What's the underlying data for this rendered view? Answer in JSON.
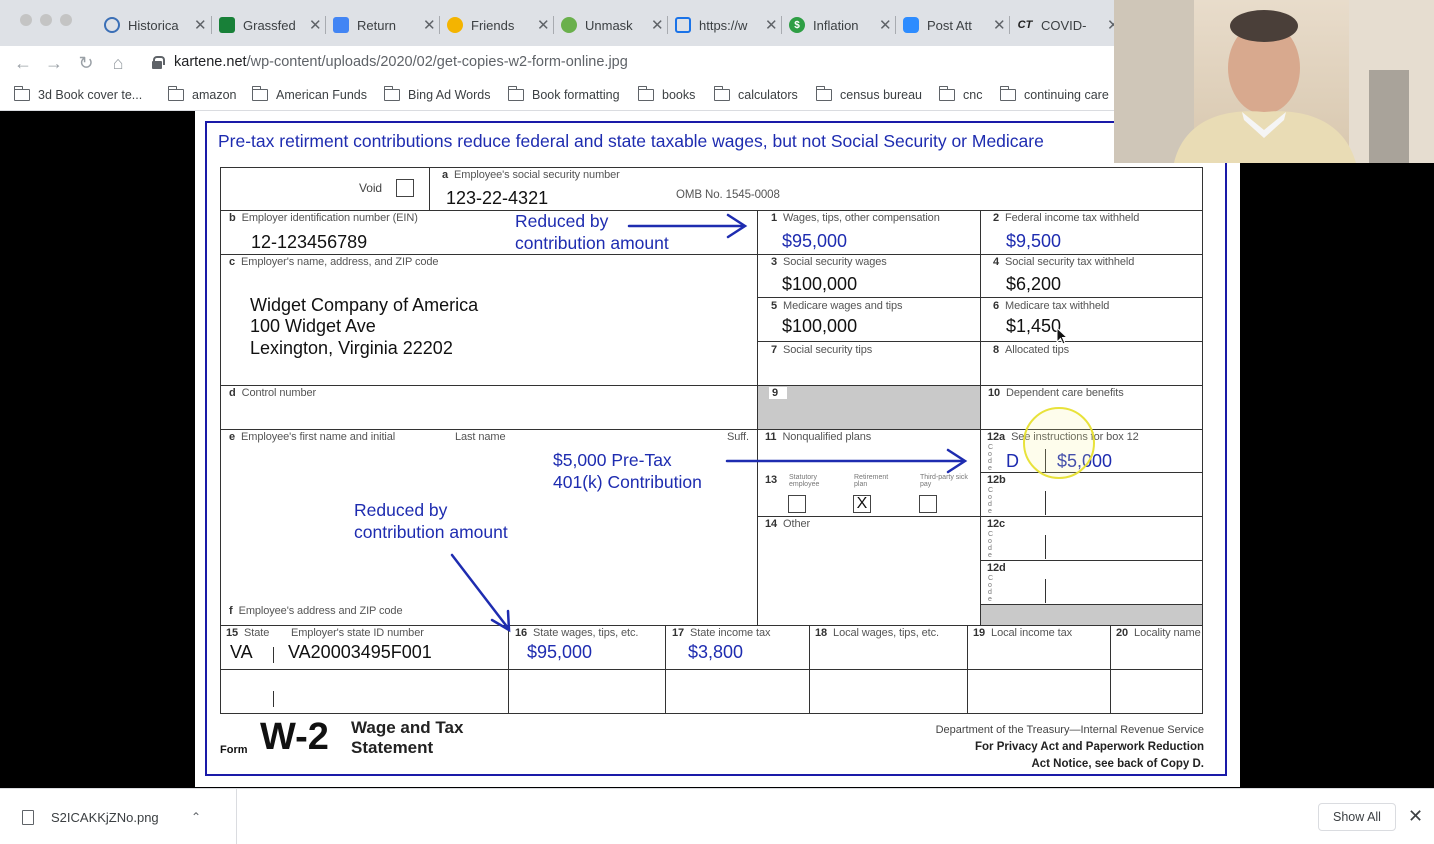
{
  "browser": {
    "tabs": [
      {
        "title": "Historica",
        "icon": "circle-logo-icon",
        "color": "#3b6fb6"
      },
      {
        "title": "Grassfed",
        "icon": "sheets-icon",
        "color": "#188038"
      },
      {
        "title": "Return",
        "icon": "docs-icon",
        "color": "#4285f4"
      },
      {
        "title": "Friends",
        "icon": "sun-icon",
        "color": "#f4b400"
      },
      {
        "title": "Unmask",
        "icon": "ufo-icon",
        "color": "#6ab04c"
      },
      {
        "title": "https://w",
        "icon": "house-icon",
        "color": "#1a73e8"
      },
      {
        "title": "Inflation",
        "icon": "dollar-icon",
        "color": "#2e9e44"
      },
      {
        "title": "Post Att",
        "icon": "zoom-icon",
        "color": "#2d8cff"
      },
      {
        "title": "COVID-",
        "icon": "ct-icon",
        "color": "#222222"
      }
    ],
    "tab_close_glyph": "✕",
    "url_host": "kartene.net",
    "url_path": "/wp-content/uploads/2020/02/get-copies-w2-form-online.jpg",
    "bookmarks": [
      "3d Book cover te...",
      "amazon",
      "American Funds",
      "Bing Ad Words",
      "Book formatting",
      "books",
      "calculators",
      "census bureau",
      "cnc",
      "continuing care"
    ]
  },
  "w2": {
    "title": "Pre-tax retirment contributions reduce federal and state taxable wages, but not Social Security or Medicare",
    "void_label": "Void",
    "ssn_label": "Employee's social security number",
    "ssn_letter": "a",
    "ssn": "123-22-4321",
    "omb": "OMB No. 1545-0008",
    "ein_letter": "b",
    "ein_label": "Employer identification number (EIN)",
    "ein": "12-123456789",
    "employer_letter": "c",
    "employer_label": "Employer's name, address, and ZIP code",
    "employer_lines": [
      "Widget Company of America",
      "100 Widget Ave",
      "Lexington, Virginia 22202"
    ],
    "control_letter": "d",
    "control_label": "Control number",
    "employee_letter": "e",
    "employee_label": "Employee's first name and initial",
    "last_name_label": "Last name",
    "suff_label": "Suff.",
    "address_letter": "f",
    "address_label": "Employee's address and ZIP code",
    "boxes": {
      "b1": {
        "num": "1",
        "label": "Wages, tips, other compensation",
        "value": "$95,000"
      },
      "b2": {
        "num": "2",
        "label": "Federal income tax withheld",
        "value": "$9,500"
      },
      "b3": {
        "num": "3",
        "label": "Social security wages",
        "value": "$100,000"
      },
      "b4": {
        "num": "4",
        "label": "Social security tax withheld",
        "value": "$6,200"
      },
      "b5": {
        "num": "5",
        "label": "Medicare wages and tips",
        "value": "$100,000"
      },
      "b6": {
        "num": "6",
        "label": "Medicare tax withheld",
        "value": "$1,450"
      },
      "b7": {
        "num": "7",
        "label": "Social security tips"
      },
      "b8": {
        "num": "8",
        "label": "Allocated tips"
      },
      "b9": {
        "num": "9"
      },
      "b10": {
        "num": "10",
        "label": "Dependent care benefits"
      },
      "b11": {
        "num": "11",
        "label": "Nonqualified plans"
      },
      "b12a": {
        "num": "12a",
        "label": "See instructions for box 12",
        "code": "D",
        "value": "$5,000"
      },
      "b12b": {
        "num": "12b"
      },
      "b12c": {
        "num": "12c"
      },
      "b12d": {
        "num": "12d"
      },
      "b13": {
        "num": "13",
        "statutory": "Statutory employee",
        "retirement": "Retirement plan",
        "sick": "Third-party sick pay",
        "retirement_mark": "X"
      },
      "b14": {
        "num": "14",
        "label": "Other"
      },
      "b15": {
        "num": "15",
        "label": "State",
        "label2": "Employer's state ID number",
        "state": "VA",
        "id": "VA20003495F001"
      },
      "b16": {
        "num": "16",
        "label": "State wages, tips, etc.",
        "value": "$95,000"
      },
      "b17": {
        "num": "17",
        "label": "State income tax",
        "value": "$3,800"
      },
      "b18": {
        "num": "18",
        "label": "Local wages, tips, etc."
      },
      "b19": {
        "num": "19",
        "label": "Local income tax"
      },
      "b20": {
        "num": "20",
        "label": "Locality name"
      }
    },
    "notes": {
      "top_line1": "Reduced by",
      "top_line2": "contribution amount",
      "mid_line1": "$5,000 Pre-Tax",
      "mid_line2": "401(k) Contribution",
      "bot_line1": "Reduced by",
      "bot_line2": "contribution amount"
    },
    "form_word": "Form",
    "form_name": "W-2",
    "form_desc1": "Wage and Tax",
    "form_desc2": "Statement",
    "dept1": "Department of the Treasury—Internal Revenue Service",
    "dept2": "For Privacy Act and Paperwork Reduction",
    "dept3": "Act Notice, see back of Copy D."
  },
  "downloads": {
    "file": "S2ICAKKjZNo.png",
    "show_all": "Show All",
    "close_glyph": "✕",
    "chevron_glyph": "⌃"
  },
  "colors": {
    "accent_blue": "#1e2cb0",
    "highlight_yellow": "#e8e23a"
  }
}
